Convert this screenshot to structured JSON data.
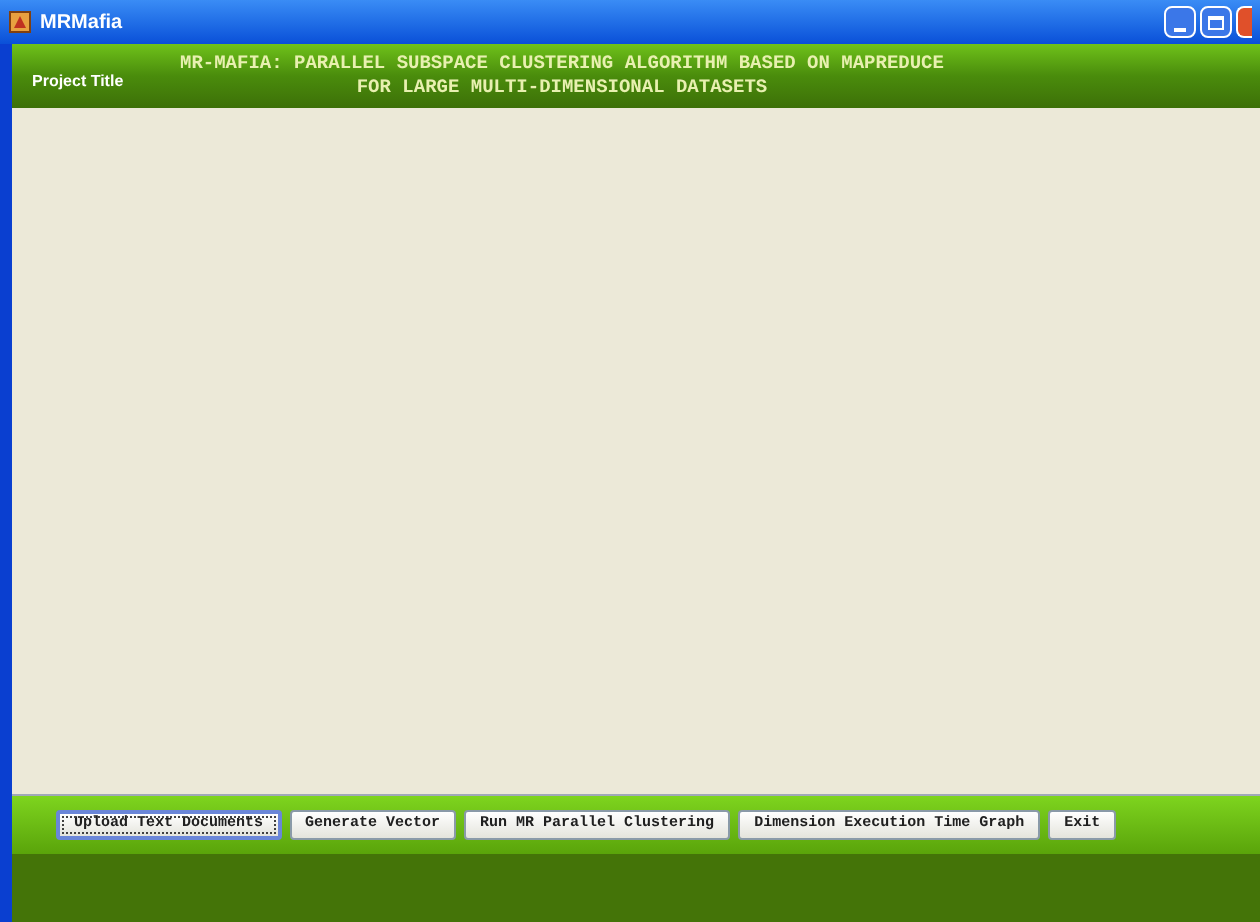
{
  "window": {
    "title": "MRMafia"
  },
  "header": {
    "label": "Project Title",
    "title_lines": [
      "MR-MAFIA: PARALLEL SUBSPACE CLUSTERING ALGORITHM BASED ON MAPREDUCE",
      "FOR LARGE MULTI-DIMENSIONAL DATASETS"
    ]
  },
  "buttons": [
    {
      "label": "Upload Text Documents",
      "focused": true
    },
    {
      "label": "Generate Vector",
      "focused": false
    },
    {
      "label": "Run MR Parallel Clustering",
      "focused": false
    },
    {
      "label": "Dimension Execution Time Graph",
      "focused": false
    },
    {
      "label": "Exit",
      "focused": false
    }
  ]
}
